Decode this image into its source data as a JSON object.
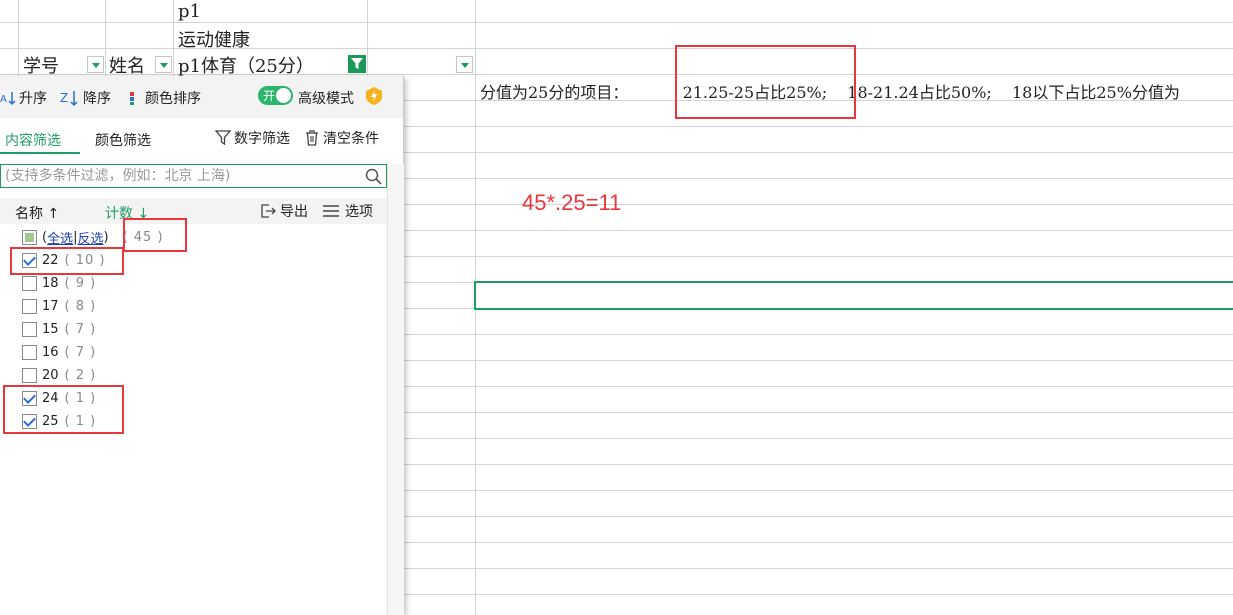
{
  "sheet": {
    "header_cells": {
      "c_row1": "p1",
      "c_row2": "运动健康",
      "a_row3": "学号",
      "b_row3": "姓名",
      "c_row3": "p1体育（25分）"
    },
    "note_text": {
      "prefix": "分值为25分的项目：",
      "part1": "21.25-25占比25%;",
      "part2": "18-21.24占比50%;",
      "part3": "18以下占比25%分值为"
    },
    "annotation": "45*.25=11"
  },
  "filter_panel": {
    "toolbar": {
      "asc_label": "升序",
      "desc_label": "降序",
      "color_sort_label": "颜色排序",
      "toggle_on_label": "开",
      "advanced_mode_label": "高级模式"
    },
    "tabs": {
      "content_filter": "内容筛选",
      "color_filter": "颜色筛选",
      "number_filter": "数字筛选",
      "clear_conditions": "清空条件"
    },
    "search": {
      "placeholder": "(支持多条件过滤，例如：北京 上海)"
    },
    "list_header": {
      "name_label": "名称",
      "count_label": "计数",
      "export_label": "导出",
      "options_label": "选项"
    },
    "select_all": {
      "all_label": "全选",
      "invert_label": "反选",
      "count": "( 45 )"
    },
    "items": [
      {
        "label": "22",
        "count": "( 10 )",
        "checked": true
      },
      {
        "label": "18",
        "count": "( 9 )",
        "checked": false
      },
      {
        "label": "17",
        "count": "( 8 )",
        "checked": false
      },
      {
        "label": "15",
        "count": "( 7 )",
        "checked": false
      },
      {
        "label": "16",
        "count": "( 7 )",
        "checked": false
      },
      {
        "label": "20",
        "count": "( 2 )",
        "checked": false
      },
      {
        "label": "24",
        "count": "( 1 )",
        "checked": true
      },
      {
        "label": "25",
        "count": "( 1 )",
        "checked": true
      }
    ]
  },
  "colors": {
    "accent_green": "#1f9e63",
    "annotation_red": "#e8383d",
    "check_blue": "#2a6fd6"
  }
}
